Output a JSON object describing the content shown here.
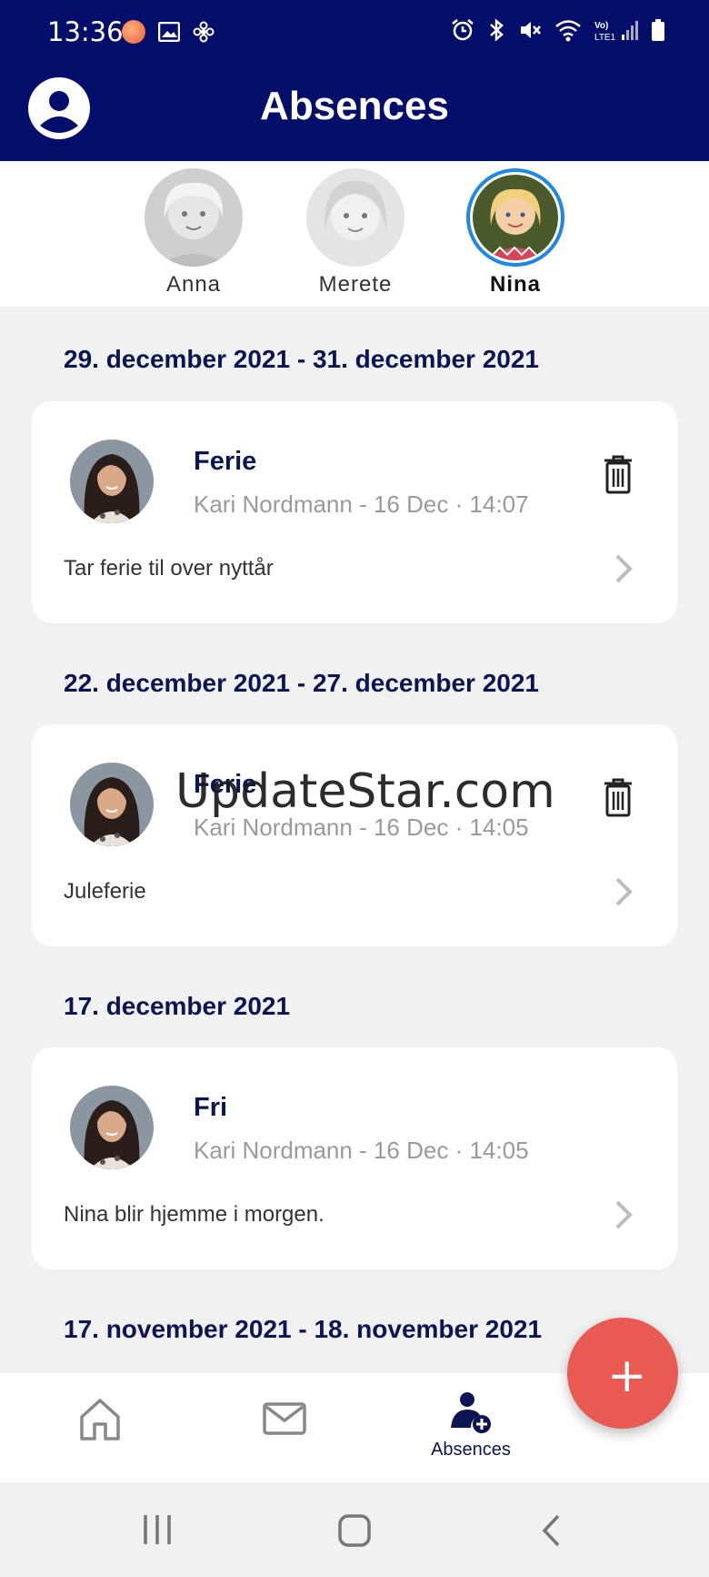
{
  "status": {
    "time": "13:36"
  },
  "header": {
    "title": "Absences"
  },
  "children": [
    {
      "name": "Anna",
      "active": false
    },
    {
      "name": "Merete",
      "active": false
    },
    {
      "name": "Nina",
      "active": true
    }
  ],
  "absences": [
    {
      "date": "29. december 2021 - 31. december 2021",
      "type": "Ferie",
      "author": "Kari Nordmann",
      "timestamp": "- 16 Dec · 14:07",
      "description": "Tar ferie til over nyttår",
      "deletable": true
    },
    {
      "date": "22. december 2021 - 27. december 2021",
      "type": "Ferie",
      "author": "Kari Nordmann",
      "timestamp": "- 16 Dec · 14:05",
      "description": "Juleferie",
      "deletable": true
    },
    {
      "date": "17. december 2021",
      "type": "Fri",
      "author": "Kari Nordmann",
      "timestamp": "- 16 Dec · 14:05",
      "description": "Nina blir hjemme i morgen.",
      "deletable": false
    },
    {
      "date": "17. november 2021 - 18. november 2021"
    }
  ],
  "watermark": "UpdateStar.com",
  "bottom_nav": {
    "home_icon": "home-icon",
    "messages_icon": "mail-icon",
    "absences_label": "Absences"
  },
  "fab": {
    "symbol": "+"
  },
  "colors": {
    "header_bg": "#030d6a",
    "accent_dark": "#0a1552",
    "fab": "#e85a52",
    "active_ring": "#1e88e5"
  }
}
